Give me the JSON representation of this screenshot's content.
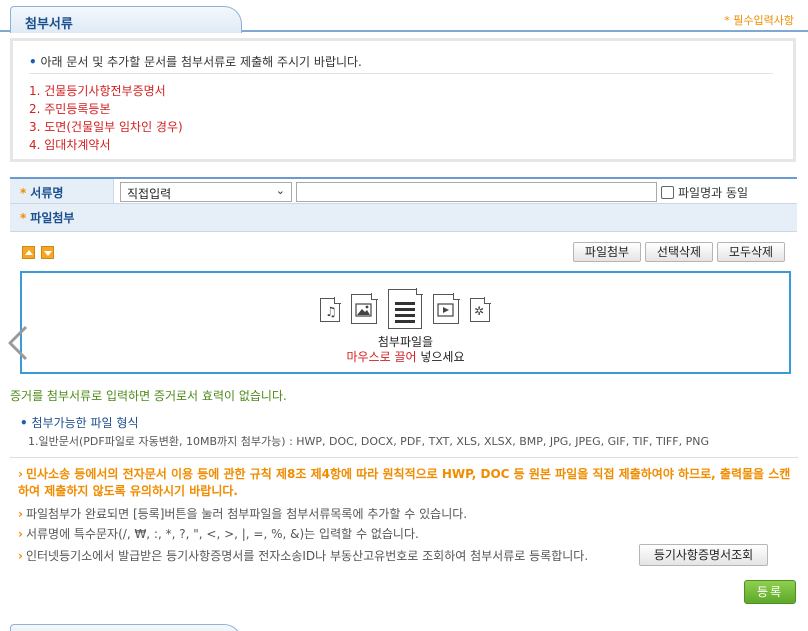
{
  "section": {
    "title": "첨부서류",
    "required_note": "* 필수입력사항"
  },
  "info": {
    "intro": "아래 문서 및 추가할 문서를 첨부서류로 제출해 주시기 바랍니다.",
    "docs": [
      "1. 건물등기사항전부증명서",
      "2. 주민등록등본",
      "3. 도면(건물일부 임차인 경우)",
      "4. 임대차계약서"
    ]
  },
  "form": {
    "doc_name_label": "서류명",
    "doc_select_value": "직접입력",
    "doc_name_input_value": "",
    "same_as_filename_label": "파일명과 동일",
    "attach_label": "파일첨부",
    "star": "*"
  },
  "toolbar": {
    "attach_button": "파일첨부",
    "delete_selected_button": "선택삭제",
    "delete_all_button": "모두삭제"
  },
  "dropzone": {
    "line1": "첨부파일을",
    "line2_red": "마우스로 끌어",
    "line2_rest": " 넣으세요"
  },
  "evidence_warning": "증거를 첨부서류로 입력하면 증거로서 효력이 없습니다.",
  "allowed": {
    "title": "첨부가능한 파일 형식",
    "list": "1.일반문서(PDF파일로 자동변환, 10MB까지 첨부가능) : HWP, DOC, DOCX, PDF, TXT, XLS, XLSX, BMP, JPG, JPEG, GIF, TIF, TIFF, PNG"
  },
  "notices": {
    "orange": "민사소송 등에서의 전자문서 이용 등에 관한 규칙 제8조 제4항에 따라 원칙적으로 HWP, DOC 등 원본 파일을 직접 제출하여야 하므로, 출력물을 스캔하여 제출하지 않도록 유의하시기 바랍니다.",
    "n1": "파일첨부가 완료되면 [등록]버튼을 눌러 첨부파일을 첨부서류목록에 추가할 수 있습니다.",
    "n2": "서류명에 특수문자(/, ₩, :, *, ?, \", <, >, |, =, %, &)는 입력할 수 없습니다.",
    "n3": "인터넷등기소에서 발급받은 등기사항증명서를 전자소송ID나 부동산고유번호로 조회하여 첨부서류로 등록합니다.",
    "lookup_button": "등기사항증명서조회"
  },
  "submit_button": "등록",
  "colors": {
    "accent": "#1c4f8f",
    "orange": "#f08c00",
    "red": "#d42020",
    "green_text": "#4c8a1a",
    "submit_green": "#6cb534"
  }
}
